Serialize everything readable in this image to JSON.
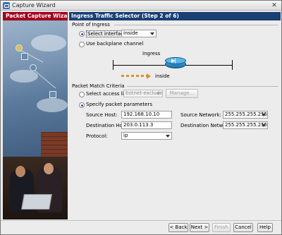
{
  "window": {
    "title": "Capture Wizard",
    "close_glyph": "✕"
  },
  "sidebar": {
    "title": "Packet Capture Wizard"
  },
  "step": {
    "title": "Ingress Traffic Selector   (Step 2 of 6)"
  },
  "point_of_ingress": {
    "section_label": "Point of Ingress",
    "select_interface_label": "Select interface:",
    "interface_value": "inside",
    "backplane_label": "Use backplane channel",
    "selected": "select_interface"
  },
  "diagram": {
    "ingress_label": "Ingress",
    "interface_label": "inside"
  },
  "packet_match": {
    "section_label": "Packet Match Criteria",
    "access_list_label": "Select access list:",
    "access_list_value": "botnet-exclude",
    "manage_label": "Manage...",
    "specify_label": "Specify packet parameters",
    "selected": "specify_parameters",
    "source_host_label": "Source Host:",
    "source_host_value": "192.168.10.10",
    "source_network_label": "Source Network:",
    "source_network_value": "255.255.255.255",
    "destination_host_label": "Destination Host:",
    "destination_host_value": "203.0.113.3",
    "destination_network_label": "Destination Network:",
    "destination_network_value": "255.255.255.255",
    "protocol_label": "Protocol:",
    "protocol_value": "ip"
  },
  "buttons": {
    "back": "< Back",
    "next": "Next >",
    "finish": "Finish",
    "cancel": "Cancel",
    "help": "Help"
  },
  "colors": {
    "step_header": "#1a3f73",
    "sidebar_header": "#a3001c",
    "router": "#2a8fd0",
    "ingress_arrow": "#e0912a"
  },
  "icons": [
    "app-icon",
    "close-icon",
    "router-icon",
    "ingress-arrow-icon",
    "dropdown-arrow-icon"
  ]
}
